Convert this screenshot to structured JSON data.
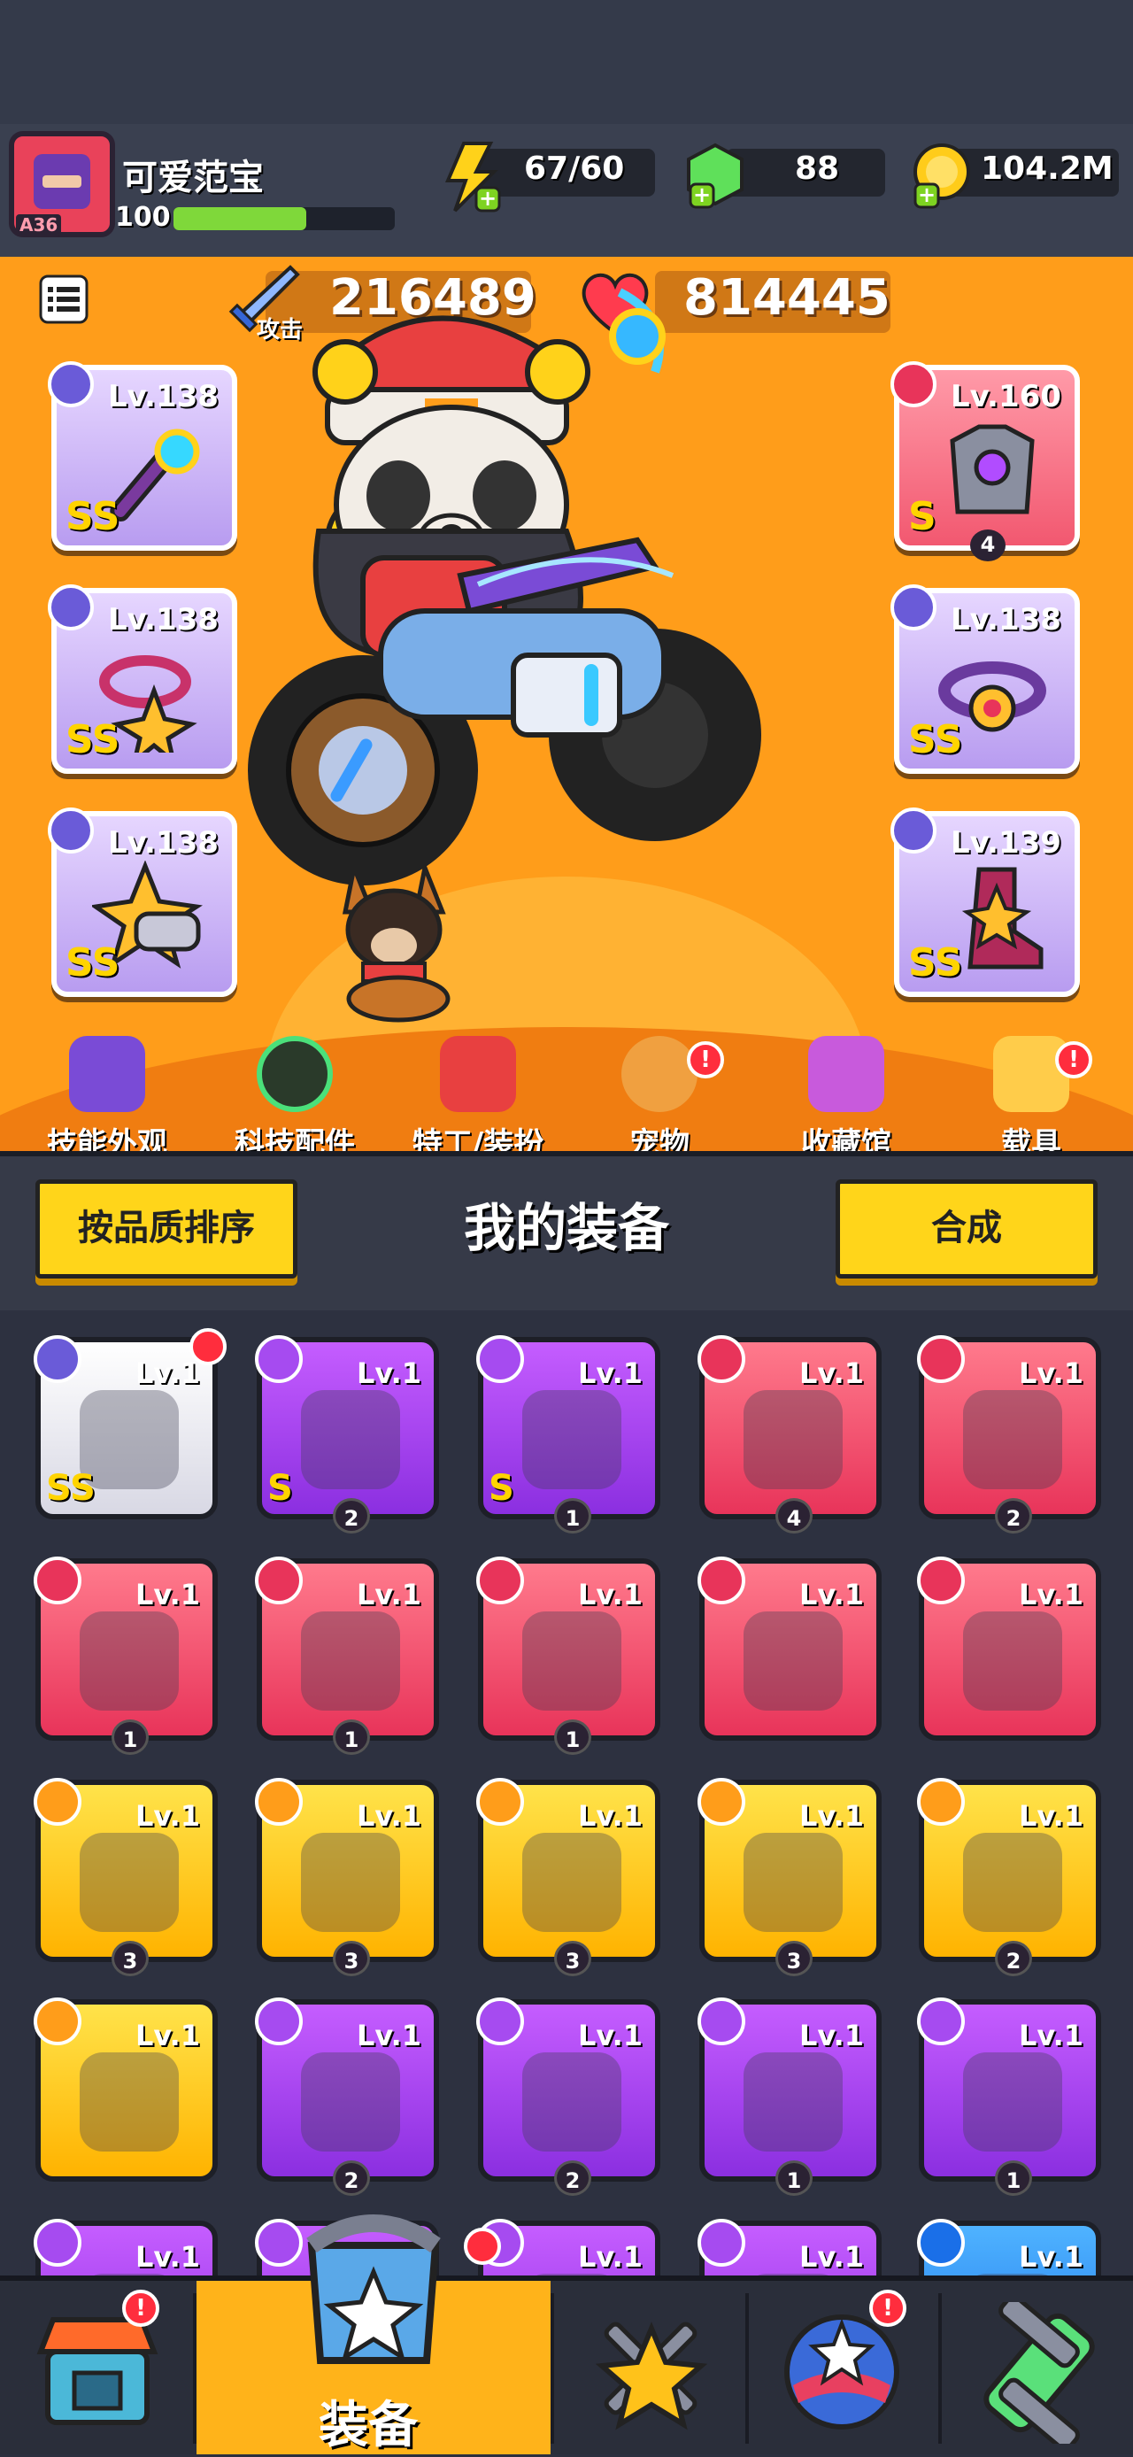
{
  "player": {
    "name": "可爱范宝",
    "level": "100",
    "tag": "A36",
    "xp_fraction": 0.6
  },
  "resources": {
    "energy": "67/60",
    "gems": "88",
    "coins": "104.2M"
  },
  "stats": {
    "attack_value": "216489",
    "attack_label": "攻击",
    "hp_value": "814445",
    "hp_label": "生命"
  },
  "equipped_left": [
    {
      "level": "Lv.138",
      "grade": "SS",
      "rarity": "purple"
    },
    {
      "level": "Lv.138",
      "grade": "SS",
      "rarity": "purple"
    },
    {
      "level": "Lv.138",
      "grade": "SS",
      "rarity": "purple"
    }
  ],
  "equipped_right": [
    {
      "level": "Lv.160",
      "grade": "S",
      "rarity": "red",
      "count": "4"
    },
    {
      "level": "Lv.138",
      "grade": "SS",
      "rarity": "purple"
    },
    {
      "level": "Lv.139",
      "grade": "SS",
      "rarity": "purple"
    }
  ],
  "menu": [
    {
      "label": "技能外观",
      "badge": ""
    },
    {
      "label": "科技配件",
      "badge": ""
    },
    {
      "label": "特工/装扮",
      "badge": ""
    },
    {
      "label": "宠物",
      "badge": "!"
    },
    {
      "label": "收藏馆",
      "badge": ""
    },
    {
      "label": "载具",
      "badge": "!"
    }
  ],
  "inventory_bar": {
    "sort_label": "按品质排序",
    "title": "我的装备",
    "merge_label": "合成"
  },
  "inventory": [
    {
      "level": "Lv.1",
      "rarity": "white",
      "grade": "SS",
      "count": "",
      "new": true
    },
    {
      "level": "Lv.1",
      "rarity": "purple",
      "grade": "S",
      "count": "2"
    },
    {
      "level": "Lv.1",
      "rarity": "purple",
      "grade": "S",
      "count": "1"
    },
    {
      "level": "Lv.1",
      "rarity": "red",
      "grade": "",
      "count": "4"
    },
    {
      "level": "Lv.1",
      "rarity": "red",
      "grade": "",
      "count": "2"
    },
    {
      "level": "Lv.1",
      "rarity": "red",
      "grade": "",
      "count": "1"
    },
    {
      "level": "Lv.1",
      "rarity": "red",
      "grade": "",
      "count": "1"
    },
    {
      "level": "Lv.1",
      "rarity": "red",
      "grade": "",
      "count": "1"
    },
    {
      "level": "Lv.1",
      "rarity": "red",
      "grade": "",
      "count": ""
    },
    {
      "level": "Lv.1",
      "rarity": "red",
      "grade": "",
      "count": ""
    },
    {
      "level": "Lv.1",
      "rarity": "yellow",
      "grade": "",
      "count": "3"
    },
    {
      "level": "Lv.1",
      "rarity": "yellow",
      "grade": "",
      "count": "3"
    },
    {
      "level": "Lv.1",
      "rarity": "yellow",
      "grade": "",
      "count": "3"
    },
    {
      "level": "Lv.1",
      "rarity": "yellow",
      "grade": "",
      "count": "3"
    },
    {
      "level": "Lv.1",
      "rarity": "yellow",
      "grade": "",
      "count": "2"
    },
    {
      "level": "Lv.1",
      "rarity": "yellow",
      "grade": "",
      "count": ""
    },
    {
      "level": "Lv.1",
      "rarity": "purple",
      "grade": "",
      "count": "2"
    },
    {
      "level": "Lv.1",
      "rarity": "purple",
      "grade": "",
      "count": "2"
    },
    {
      "level": "Lv.1",
      "rarity": "purple",
      "grade": "",
      "count": "1"
    },
    {
      "level": "Lv.1",
      "rarity": "purple",
      "grade": "",
      "count": "1"
    },
    {
      "level": "Lv.1",
      "rarity": "purple",
      "grade": "",
      "count": ""
    },
    {
      "level": "Lv.1",
      "rarity": "purple",
      "grade": "",
      "count": ""
    },
    {
      "level": "Lv.1",
      "rarity": "purple",
      "grade": "",
      "count": ""
    },
    {
      "level": "Lv.1",
      "rarity": "purple",
      "grade": "",
      "count": ""
    },
    {
      "level": "Lv.1",
      "rarity": "blue",
      "grade": "",
      "count": ""
    }
  ],
  "nav": [
    {
      "icon": "shop-icon",
      "label": "",
      "badge": "!"
    },
    {
      "icon": "equipment-icon",
      "label": "装备",
      "badge": ""
    },
    {
      "icon": "battle-icon",
      "label": "",
      "badge": ""
    },
    {
      "icon": "world-icon",
      "label": "",
      "badge": "!"
    },
    {
      "icon": "dna-icon",
      "label": "",
      "badge": ""
    }
  ],
  "colors": {
    "hero_bg": "#ff9d1a",
    "accent_yellow": "#ffd51a",
    "xp_green": "#7fd83a"
  }
}
